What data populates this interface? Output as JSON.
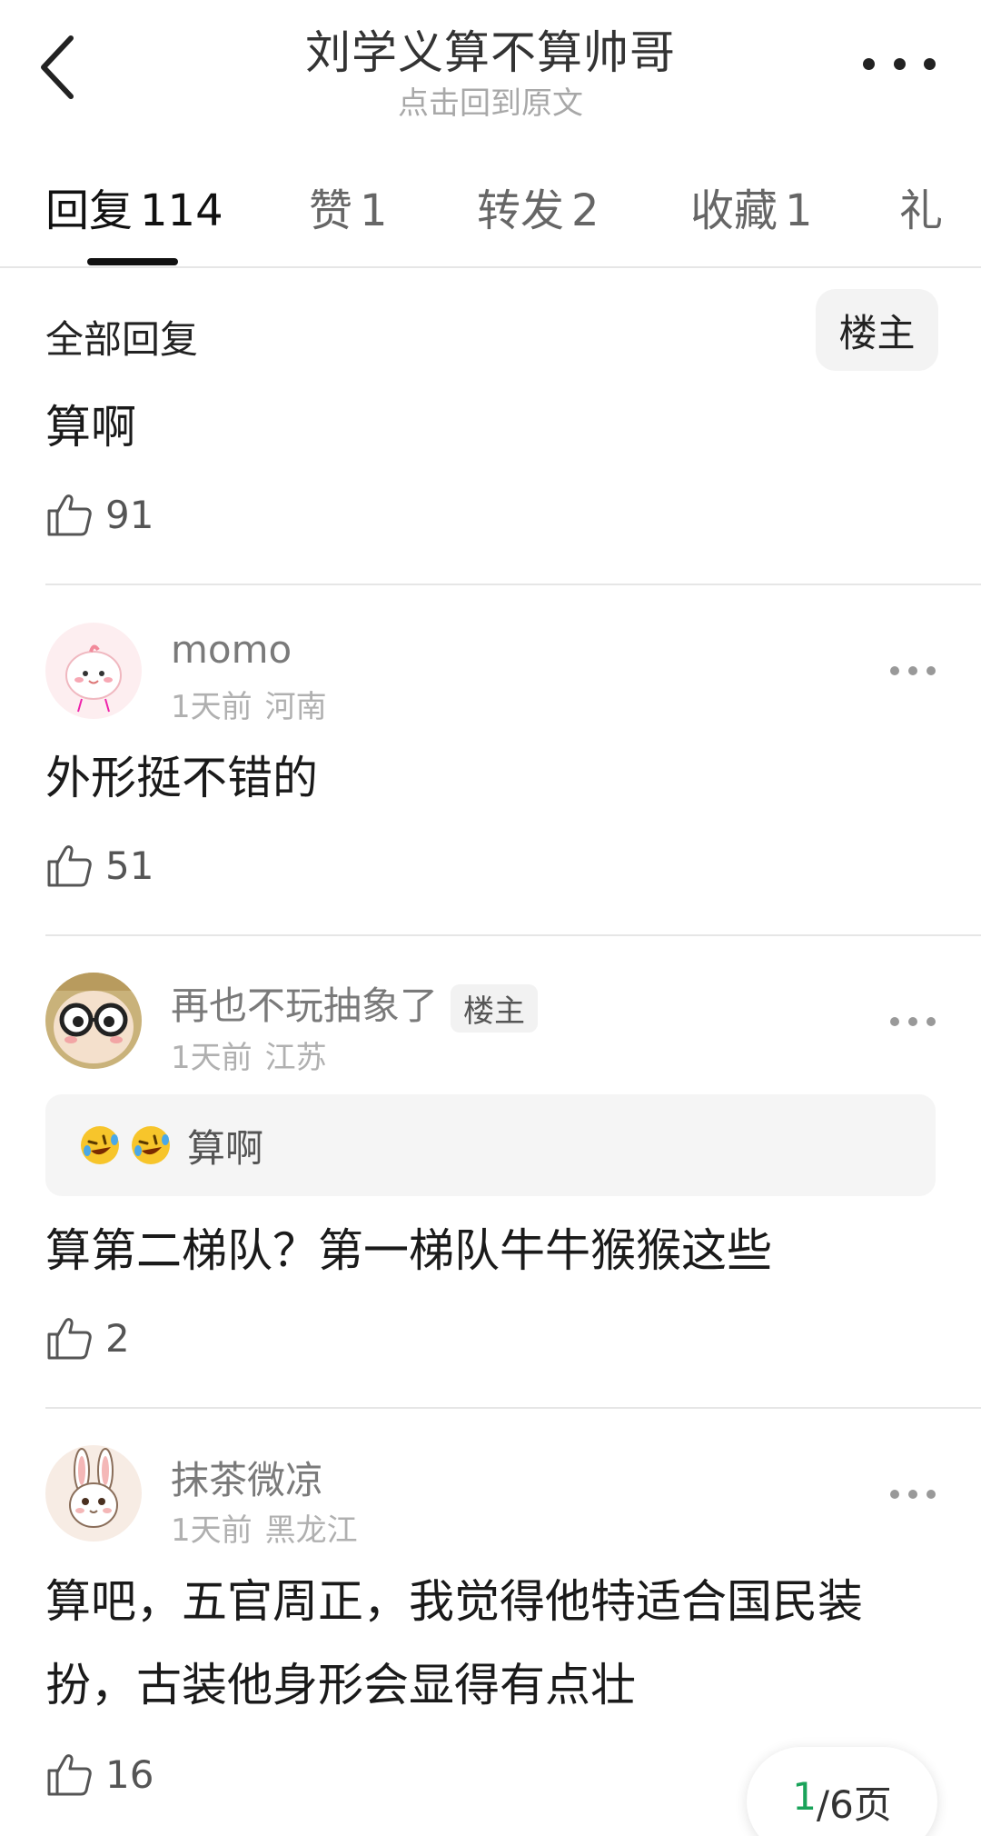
{
  "header": {
    "title": "刘学义算不算帅哥",
    "subtitle": "点击回到原文"
  },
  "tabs": [
    {
      "label": "回复",
      "count": "114"
    },
    {
      "label": "赞",
      "count": "1"
    },
    {
      "label": "转发",
      "count": "2"
    },
    {
      "label": "收藏",
      "count": "1"
    },
    {
      "label": "礼",
      "count": ""
    }
  ],
  "filter": {
    "label": "全部回复",
    "op_only": "楼主"
  },
  "comments": [
    {
      "text": "算啊",
      "likes": "91"
    },
    {
      "username": "momo",
      "time": "1天前",
      "location": "河南",
      "text": "外形挺不错的",
      "likes": "51",
      "avatar_icon": "cartoon-creature-avatar"
    },
    {
      "username": "再也不玩抽象了",
      "badge": "楼主",
      "time": "1天前",
      "location": "江苏",
      "quote": "算啊",
      "quote_emojis": [
        "rofl-emoji",
        "rofl-emoji"
      ],
      "text": "算第二梯队？第一梯队牛牛猴猴这些",
      "likes": "2",
      "avatar_icon": "glasses-face-avatar"
    },
    {
      "username": "抹茶微凉",
      "time": "1天前",
      "location": "黑龙江",
      "text_line1": "算吧，五官周正，我觉得他特适合国民装",
      "text_line2": "扮，古装他身形会显得有点壮",
      "likes": "16",
      "avatar_icon": "bunny-avatar"
    }
  ],
  "pager": {
    "current": "1",
    "suffix": "/6页"
  },
  "colors": {
    "accent_green": "#1aa35a",
    "text_primary": "#1a1a1a",
    "text_muted": "#7a7a7a",
    "divider": "#e6e6e6"
  }
}
